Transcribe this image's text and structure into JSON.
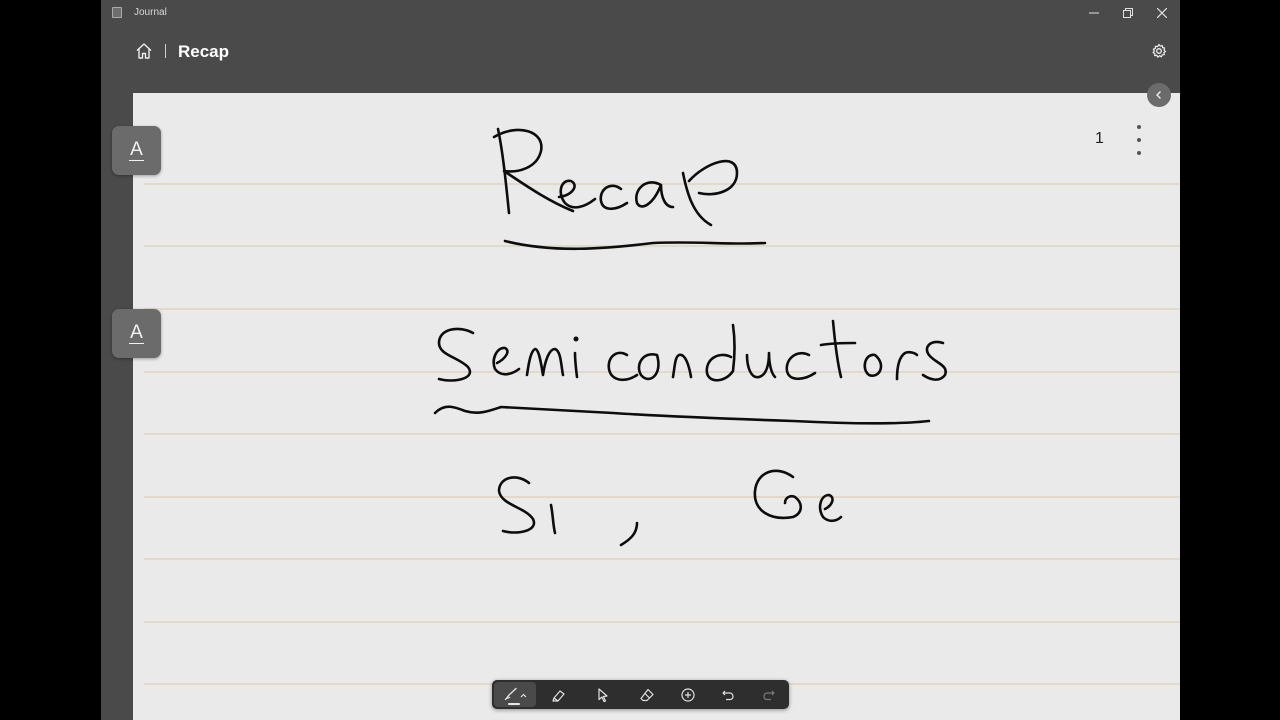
{
  "window": {
    "app_title": "Journal"
  },
  "appbar": {
    "page_title": "Recap"
  },
  "page": {
    "number": "1",
    "handwriting": [
      "Recap",
      "Semiconductors",
      "Si",
      ",",
      "Ge"
    ]
  },
  "text_tools": [
    "A",
    "A"
  ],
  "toolbar": {
    "tools": [
      "pen",
      "highlighter",
      "select",
      "eraser",
      "add",
      "undo",
      "redo"
    ],
    "active": "pen"
  },
  "colors": {
    "chrome": "#4a4a4a",
    "page": "#ebeaea",
    "rule": "#e3d9c9",
    "ink": "#0d0d0d",
    "toolbar": "#2e2e2e"
  }
}
